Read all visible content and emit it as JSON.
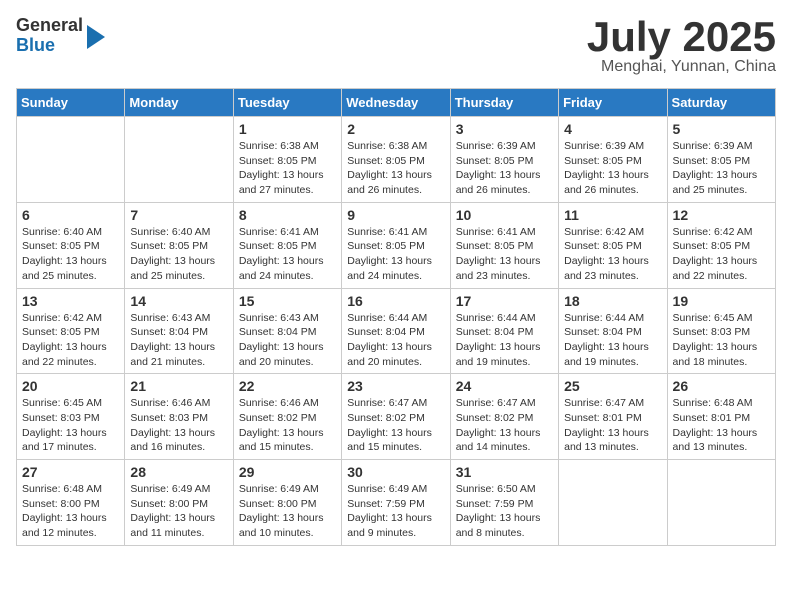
{
  "logo": {
    "line1": "General",
    "line2": "Blue"
  },
  "title": "July 2025",
  "subtitle": "Menghai, Yunnan, China",
  "weekdays": [
    "Sunday",
    "Monday",
    "Tuesday",
    "Wednesday",
    "Thursday",
    "Friday",
    "Saturday"
  ],
  "weeks": [
    [
      {
        "day": "",
        "info": ""
      },
      {
        "day": "",
        "info": ""
      },
      {
        "day": "1",
        "info": "Sunrise: 6:38 AM\nSunset: 8:05 PM\nDaylight: 13 hours and 27 minutes."
      },
      {
        "day": "2",
        "info": "Sunrise: 6:38 AM\nSunset: 8:05 PM\nDaylight: 13 hours and 26 minutes."
      },
      {
        "day": "3",
        "info": "Sunrise: 6:39 AM\nSunset: 8:05 PM\nDaylight: 13 hours and 26 minutes."
      },
      {
        "day": "4",
        "info": "Sunrise: 6:39 AM\nSunset: 8:05 PM\nDaylight: 13 hours and 26 minutes."
      },
      {
        "day": "5",
        "info": "Sunrise: 6:39 AM\nSunset: 8:05 PM\nDaylight: 13 hours and 25 minutes."
      }
    ],
    [
      {
        "day": "6",
        "info": "Sunrise: 6:40 AM\nSunset: 8:05 PM\nDaylight: 13 hours and 25 minutes."
      },
      {
        "day": "7",
        "info": "Sunrise: 6:40 AM\nSunset: 8:05 PM\nDaylight: 13 hours and 25 minutes."
      },
      {
        "day": "8",
        "info": "Sunrise: 6:41 AM\nSunset: 8:05 PM\nDaylight: 13 hours and 24 minutes."
      },
      {
        "day": "9",
        "info": "Sunrise: 6:41 AM\nSunset: 8:05 PM\nDaylight: 13 hours and 24 minutes."
      },
      {
        "day": "10",
        "info": "Sunrise: 6:41 AM\nSunset: 8:05 PM\nDaylight: 13 hours and 23 minutes."
      },
      {
        "day": "11",
        "info": "Sunrise: 6:42 AM\nSunset: 8:05 PM\nDaylight: 13 hours and 23 minutes."
      },
      {
        "day": "12",
        "info": "Sunrise: 6:42 AM\nSunset: 8:05 PM\nDaylight: 13 hours and 22 minutes."
      }
    ],
    [
      {
        "day": "13",
        "info": "Sunrise: 6:42 AM\nSunset: 8:05 PM\nDaylight: 13 hours and 22 minutes."
      },
      {
        "day": "14",
        "info": "Sunrise: 6:43 AM\nSunset: 8:04 PM\nDaylight: 13 hours and 21 minutes."
      },
      {
        "day": "15",
        "info": "Sunrise: 6:43 AM\nSunset: 8:04 PM\nDaylight: 13 hours and 20 minutes."
      },
      {
        "day": "16",
        "info": "Sunrise: 6:44 AM\nSunset: 8:04 PM\nDaylight: 13 hours and 20 minutes."
      },
      {
        "day": "17",
        "info": "Sunrise: 6:44 AM\nSunset: 8:04 PM\nDaylight: 13 hours and 19 minutes."
      },
      {
        "day": "18",
        "info": "Sunrise: 6:44 AM\nSunset: 8:04 PM\nDaylight: 13 hours and 19 minutes."
      },
      {
        "day": "19",
        "info": "Sunrise: 6:45 AM\nSunset: 8:03 PM\nDaylight: 13 hours and 18 minutes."
      }
    ],
    [
      {
        "day": "20",
        "info": "Sunrise: 6:45 AM\nSunset: 8:03 PM\nDaylight: 13 hours and 17 minutes."
      },
      {
        "day": "21",
        "info": "Sunrise: 6:46 AM\nSunset: 8:03 PM\nDaylight: 13 hours and 16 minutes."
      },
      {
        "day": "22",
        "info": "Sunrise: 6:46 AM\nSunset: 8:02 PM\nDaylight: 13 hours and 15 minutes."
      },
      {
        "day": "23",
        "info": "Sunrise: 6:47 AM\nSunset: 8:02 PM\nDaylight: 13 hours and 15 minutes."
      },
      {
        "day": "24",
        "info": "Sunrise: 6:47 AM\nSunset: 8:02 PM\nDaylight: 13 hours and 14 minutes."
      },
      {
        "day": "25",
        "info": "Sunrise: 6:47 AM\nSunset: 8:01 PM\nDaylight: 13 hours and 13 minutes."
      },
      {
        "day": "26",
        "info": "Sunrise: 6:48 AM\nSunset: 8:01 PM\nDaylight: 13 hours and 13 minutes."
      }
    ],
    [
      {
        "day": "27",
        "info": "Sunrise: 6:48 AM\nSunset: 8:00 PM\nDaylight: 13 hours and 12 minutes."
      },
      {
        "day": "28",
        "info": "Sunrise: 6:49 AM\nSunset: 8:00 PM\nDaylight: 13 hours and 11 minutes."
      },
      {
        "day": "29",
        "info": "Sunrise: 6:49 AM\nSunset: 8:00 PM\nDaylight: 13 hours and 10 minutes."
      },
      {
        "day": "30",
        "info": "Sunrise: 6:49 AM\nSunset: 7:59 PM\nDaylight: 13 hours and 9 minutes."
      },
      {
        "day": "31",
        "info": "Sunrise: 6:50 AM\nSunset: 7:59 PM\nDaylight: 13 hours and 8 minutes."
      },
      {
        "day": "",
        "info": ""
      },
      {
        "day": "",
        "info": ""
      }
    ]
  ]
}
